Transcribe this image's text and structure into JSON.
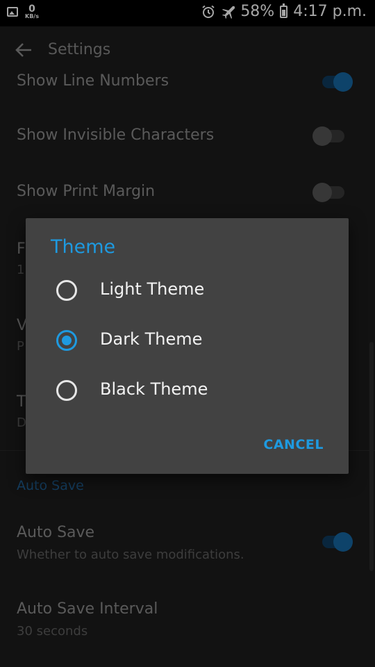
{
  "status_bar": {
    "net_speed_value": "0",
    "net_speed_unit": "KB/s",
    "battery": "58%",
    "time": "4:17 p.m.",
    "icons": [
      "image-icon",
      "alarm-icon",
      "airplane-icon",
      "battery-icon"
    ]
  },
  "header": {
    "title": "Settings",
    "back_icon": "arrow-back-icon"
  },
  "settings": {
    "show_line_numbers": {
      "label": "Show Line Numbers",
      "enabled": true
    },
    "show_invisible_chars": {
      "label": "Show Invisible Characters",
      "enabled": false
    },
    "show_print_margin": {
      "label": "Show Print Margin",
      "enabled": false
    },
    "partially_hidden": {
      "row1_title": "F",
      "row1_sub": "1",
      "row2_title": "V",
      "row2_sub": "P",
      "row3_title": "T",
      "row3_sub": "D"
    },
    "auto_save_section": "Auto Save",
    "auto_save": {
      "label": "Auto Save",
      "summary": "Whether to auto save modifications.",
      "enabled": true
    },
    "auto_save_interval": {
      "label": "Auto Save Interval",
      "summary": "30 seconds"
    }
  },
  "dialog": {
    "title": "Theme",
    "options": [
      {
        "label": "Light Theme",
        "selected": false
      },
      {
        "label": "Dark Theme",
        "selected": true
      },
      {
        "label": "Black Theme",
        "selected": false
      }
    ],
    "cancel_label": "CANCEL"
  },
  "colors": {
    "accent": "#1e9ae0",
    "dialog_bg": "#424242",
    "app_bg": "#1c1c1c"
  }
}
